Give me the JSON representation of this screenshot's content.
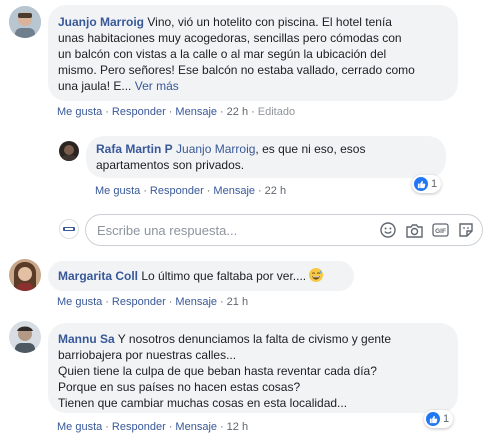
{
  "comments": [
    {
      "author": "Juanjo Marroig",
      "lines": [
        "Vino, vió un hotelito con piscina. El hotel tenía",
        "unas habitaciones muy acogedoras, sencillas pero cómodas con",
        "un balcón con vistas a la calle o al mar según la ubicación del",
        "mismo. Pero señores! Ese balcón no estaba vallado, cerrado como",
        "una jaula! E..."
      ],
      "see_more": "Ver más",
      "actions": {
        "like": "Me gusta",
        "reply": "Responder",
        "message": "Mensaje",
        "time": "22 h",
        "edited": "Editado"
      }
    },
    {
      "author": "Rafa Martin P",
      "mention": "Juanjo Marroig",
      "lines": [
        ", es que ni eso, esos",
        "apartamentos son privados."
      ],
      "actions": {
        "like": "Me gusta",
        "reply": "Responder",
        "message": "Mensaje",
        "time": "22 h"
      },
      "reactions": {
        "count": "1"
      }
    },
    {
      "author": "Margarita Coll",
      "lines": [
        "Lo último que faltaba por ver...."
      ],
      "emoji": "grinning-sweat-face",
      "actions": {
        "like": "Me gusta",
        "reply": "Responder",
        "message": "Mensaje",
        "time": "21 h"
      }
    },
    {
      "author": "Mannu Sa",
      "lines": [
        "Y nosotros denunciamos la falta de civismo y gente",
        "barriobajera por nuestras calles...",
        "Quien tiene la culpa de que beban hasta reventar cada día?",
        "Porque en sus países no hacen estas cosas?",
        "Tienen que cambiar muchas cosas en esta localidad..."
      ],
      "actions": {
        "like": "Me gusta",
        "reply": "Responder",
        "message": "Mensaje",
        "time": "12 h"
      },
      "reactions": {
        "count": "1"
      }
    }
  ],
  "reply_box": {
    "placeholder": "Escribe una respuesta...",
    "icons": [
      "emoji-icon",
      "camera-icon",
      "gif-icon",
      "sticker-icon"
    ]
  },
  "colors": {
    "link": "#385898",
    "bubble": "#f2f3f5",
    "like": "#2078f4"
  }
}
